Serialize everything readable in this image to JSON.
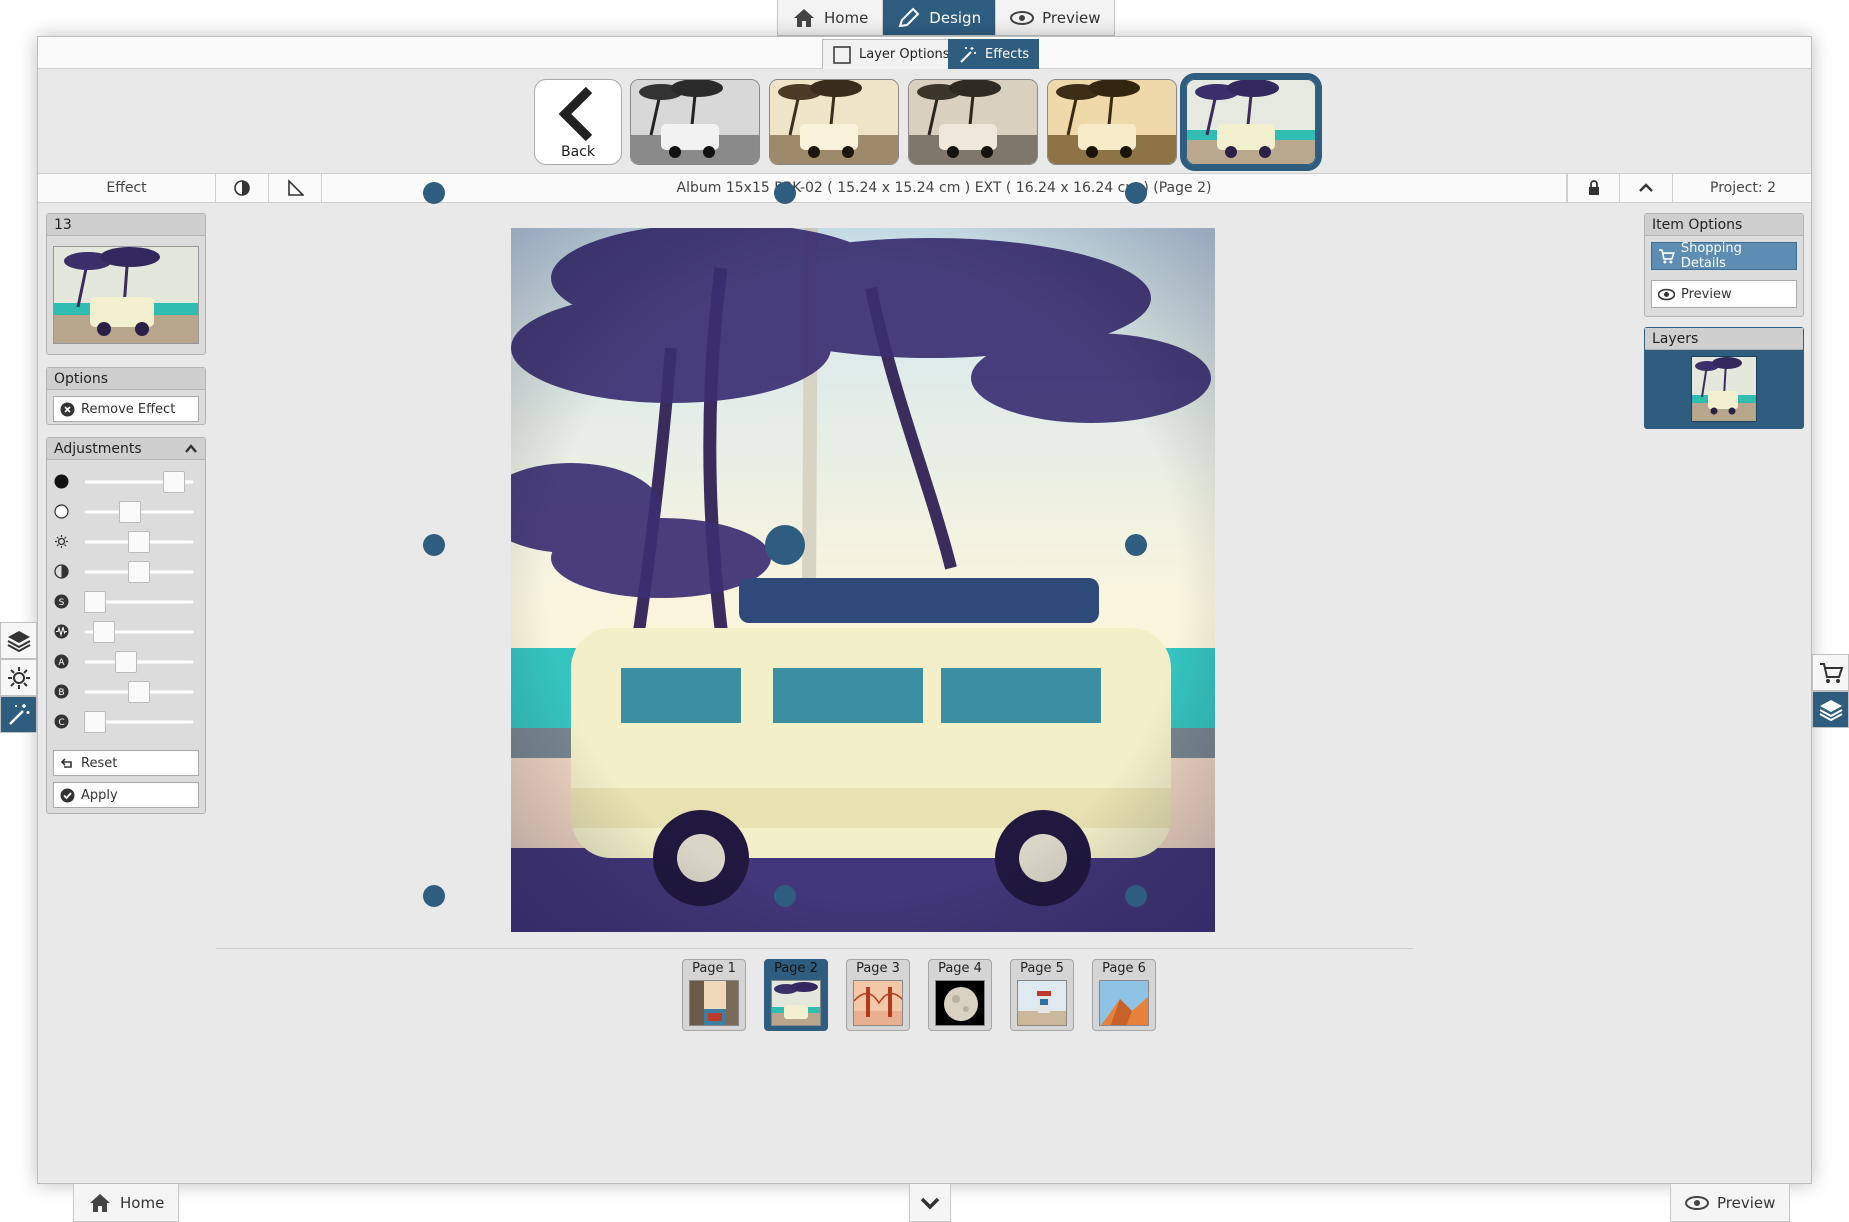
{
  "topnav": [
    {
      "label": "Home",
      "icon": "home-icon"
    },
    {
      "label": "Design",
      "icon": "pencil-icon",
      "active": true
    },
    {
      "label": "Preview",
      "icon": "eye-icon"
    }
  ],
  "subtabs": {
    "layer_options": "Layer Options",
    "effects": "Effects"
  },
  "effects_bar": {
    "back_label": "Back",
    "selected_index": 4
  },
  "infobar": {
    "left_label": "Effect",
    "title": "Album 15x15 PBK-02 ( 15.24 x 15.24 cm ) EXT ( 16.24 x 16.24 cm ) (Page 2)",
    "project": "Project: 2"
  },
  "left_panel": {
    "effect_number": "13",
    "options_title": "Options",
    "remove_effect": "Remove Effect",
    "adjustments_title": "Adjustments",
    "sliders": [
      {
        "name": "black-point",
        "icon": "black-circle-icon",
        "level": 0.9
      },
      {
        "name": "white-point",
        "icon": "white-circle-icon",
        "level": 0.4
      },
      {
        "name": "brightness",
        "icon": "sun-icon",
        "level": 0.5
      },
      {
        "name": "contrast",
        "icon": "contrast-icon",
        "level": 0.5
      },
      {
        "name": "saturation",
        "icon": "s-icon",
        "level": 0.0
      },
      {
        "name": "noise",
        "icon": "wave-icon",
        "level": 0.1
      },
      {
        "name": "a-channel",
        "icon": "a-icon",
        "level": 0.35
      },
      {
        "name": "b-channel",
        "icon": "b-icon",
        "level": 0.5
      },
      {
        "name": "c-channel",
        "icon": "c-icon",
        "level": 0.0
      }
    ],
    "reset": "Reset",
    "apply": "Apply"
  },
  "right_panel": {
    "item_options_title": "Item Options",
    "shopping_details": "Shopping Details",
    "preview": "Preview",
    "layers_title": "Layers"
  },
  "pages": [
    "Page 1",
    "Page 2",
    "Page 3",
    "Page 4",
    "Page 5",
    "Page 6"
  ],
  "selected_page": 1,
  "bottombar": {
    "home": "Home",
    "preview": "Preview"
  },
  "colors": {
    "accent": "#2f5d80",
    "panel": "#dcdcdc",
    "background": "#e9e9e9"
  }
}
